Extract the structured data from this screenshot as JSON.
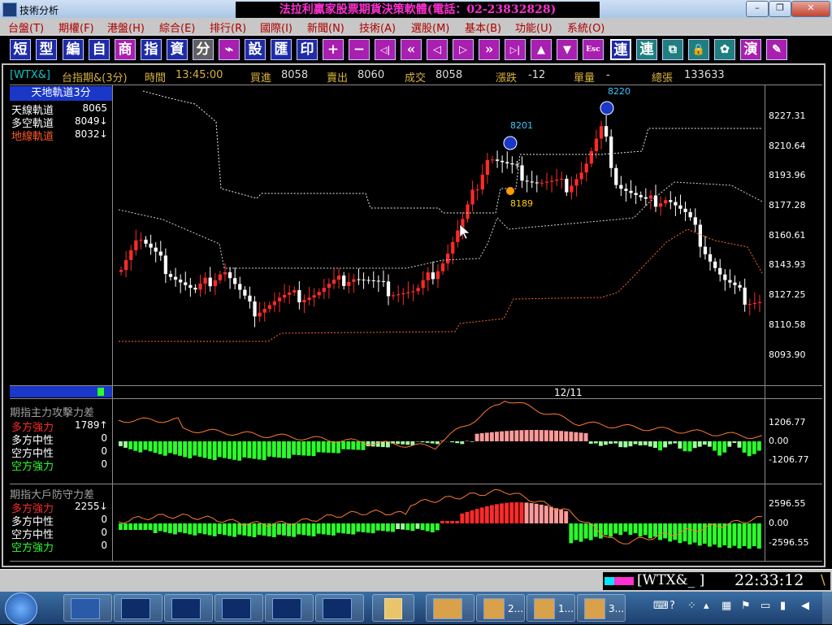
{
  "window": {
    "title": "技術分析",
    "banner": "法拉利贏家股票期貨決策軟體(電話：02-23832828)",
    "controls": [
      "–",
      "❐",
      "✕"
    ]
  },
  "menu": [
    "台盤(T)",
    "期權(F)",
    "港盤(H)",
    "綜合(E)",
    "排行(R)",
    "國際(I)",
    "新聞(N)",
    "技術(A)",
    "選股(M)",
    "基本(B)",
    "功能(U)",
    "系統(O)"
  ],
  "toolbar": {
    "buttons": [
      "短",
      "型",
      "編",
      "自",
      "商",
      "指",
      "資",
      "分",
      "⌁",
      "設",
      "匯",
      "印",
      "+",
      "−",
      "◁|",
      "«",
      "◁",
      "▷",
      "»",
      "▷|",
      "▲",
      "▼",
      "Esc",
      "連",
      "連",
      "⧉",
      "🔒",
      "✿",
      "演",
      "✎"
    ]
  },
  "quote": {
    "code": "[WTX&]",
    "name": "台指期&(3分)",
    "time_label": "時間",
    "time": "13:45:00",
    "bid_label": "買進",
    "bid": "8058",
    "ask_label": "賣出",
    "ask": "8060",
    "trade_label": "成交",
    "trade": "8058",
    "change_label": "漲跌",
    "change": "-12",
    "volume_label": "單量",
    "volume": "-",
    "total_label": "總張",
    "total": "133633"
  },
  "main_panel": {
    "header": "天地軌道3分",
    "rows": [
      {
        "label": "天線軌道",
        "value": "8065",
        "color": "#ffffff"
      },
      {
        "label": "多空軌道",
        "value": "8049↓",
        "color": "#ffffff"
      },
      {
        "label": "地線軌道",
        "value": "8032↓",
        "color": "#ff5a2a"
      }
    ],
    "y_ticks": [
      "8227.31",
      "8210.64",
      "8193.96",
      "8177.28",
      "8160.61",
      "8143.93",
      "8127.25",
      "8110.58",
      "8093.90"
    ],
    "date_label": "12/11",
    "annotations": [
      {
        "label": "8201",
        "kind": "down-arrow"
      },
      {
        "label": "8220",
        "kind": "down-arrow"
      },
      {
        "label": "8189",
        "kind": "dot"
      }
    ]
  },
  "panel2": {
    "title": "期指主力攻擊力差",
    "rows": [
      {
        "label": "多方強力",
        "value": "1789↑",
        "color": "#ff2a2a"
      },
      {
        "label": "多方中性",
        "value": "0",
        "color": "#ffffff"
      },
      {
        "label": "空方中性",
        "value": "0",
        "color": "#ffffff"
      },
      {
        "label": "空方強力",
        "value": "0",
        "color": "#2aff2a"
      }
    ],
    "y_ticks": [
      "1206.77",
      "0.00",
      "-1206.77"
    ]
  },
  "panel3": {
    "title": "期指大戶防守力差",
    "rows": [
      {
        "label": "多方強力",
        "value": "2255↓",
        "color": "#ff2a2a"
      },
      {
        "label": "多方中性",
        "value": "0",
        "color": "#ffffff"
      },
      {
        "label": "空方中性",
        "value": "0",
        "color": "#ffffff"
      },
      {
        "label": "空方強力",
        "value": "0",
        "color": "#2aff2a"
      }
    ],
    "y_ticks": [
      "2596.55",
      "0.00",
      "-2596.55"
    ]
  },
  "status": {
    "code": "[WTX&_ ]",
    "clock": "22:33:12"
  },
  "taskbar": {
    "windows": [
      {
        "label": ""
      },
      {
        "label": ""
      },
      {
        "label": ""
      },
      {
        "label": ""
      },
      {
        "label": ""
      },
      {
        "label": ""
      },
      {
        "label": "",
        "icon": "folder-icon"
      },
      {
        "label": ""
      },
      {
        "label": "2..."
      },
      {
        "label": "1..."
      },
      {
        "label": "3..."
      }
    ]
  }
}
